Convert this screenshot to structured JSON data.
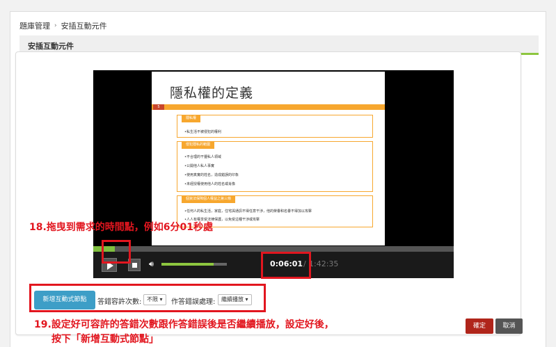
{
  "breadcrumb": {
    "root": "題庫管理",
    "separator": "›",
    "current": "安插互動元件"
  },
  "section": {
    "title": "安插互動元件"
  },
  "slide": {
    "title": "隱私權的定義",
    "number": "5",
    "boxes": [
      {
        "header": "隱私權",
        "lines": [
          "•私生活不被侵犯的權利"
        ]
      },
      {
        "header": "侵犯隱私的範圍",
        "lines": [
          "•不合理的干擾私人領域",
          "•公開他人私人事實",
          "•使用真實的姓名，造成錯誤的印象",
          "•未經授權使用他人的姓名或肖像"
        ]
      },
      {
        "header": "個資法保障個人權益之第三條",
        "lines": [
          "•任何人的私生活，家庭，住宅與通訊不得任意干涉，他的榮譽和名譽不得加以攻擊",
          "•人人有權享受法律保護，以免受這種干涉或攻擊"
        ]
      }
    ]
  },
  "player": {
    "progress": 0.06,
    "volume": 0.8,
    "current_time": "0:06:01",
    "separator": "/",
    "total_time": "1:42:35"
  },
  "annotations": {
    "step18_num": "18.",
    "step18_text": "拖曳到需求的時間點，例如6分01秒處",
    "step19_num": "19.",
    "step19_line1": "設定好可容許的答錯次數跟作答錯誤後是否繼續播放，設定好後，",
    "step19_line2": "按下「新增互動式節點」"
  },
  "form": {
    "add_button": "新增互動式節點",
    "tolerance_label": "答錯容許次數:",
    "tolerance_value": "不限",
    "error_label": "作答錯誤處理:",
    "error_value": "繼續播放"
  },
  "actions": {
    "confirm": "確定",
    "cancel": "取消"
  },
  "colors": {
    "accent_green": "#8dc63f",
    "annotation_red": "#e2161f",
    "button_blue": "#3d9ec7",
    "confirm_red": "#b0251b"
  }
}
